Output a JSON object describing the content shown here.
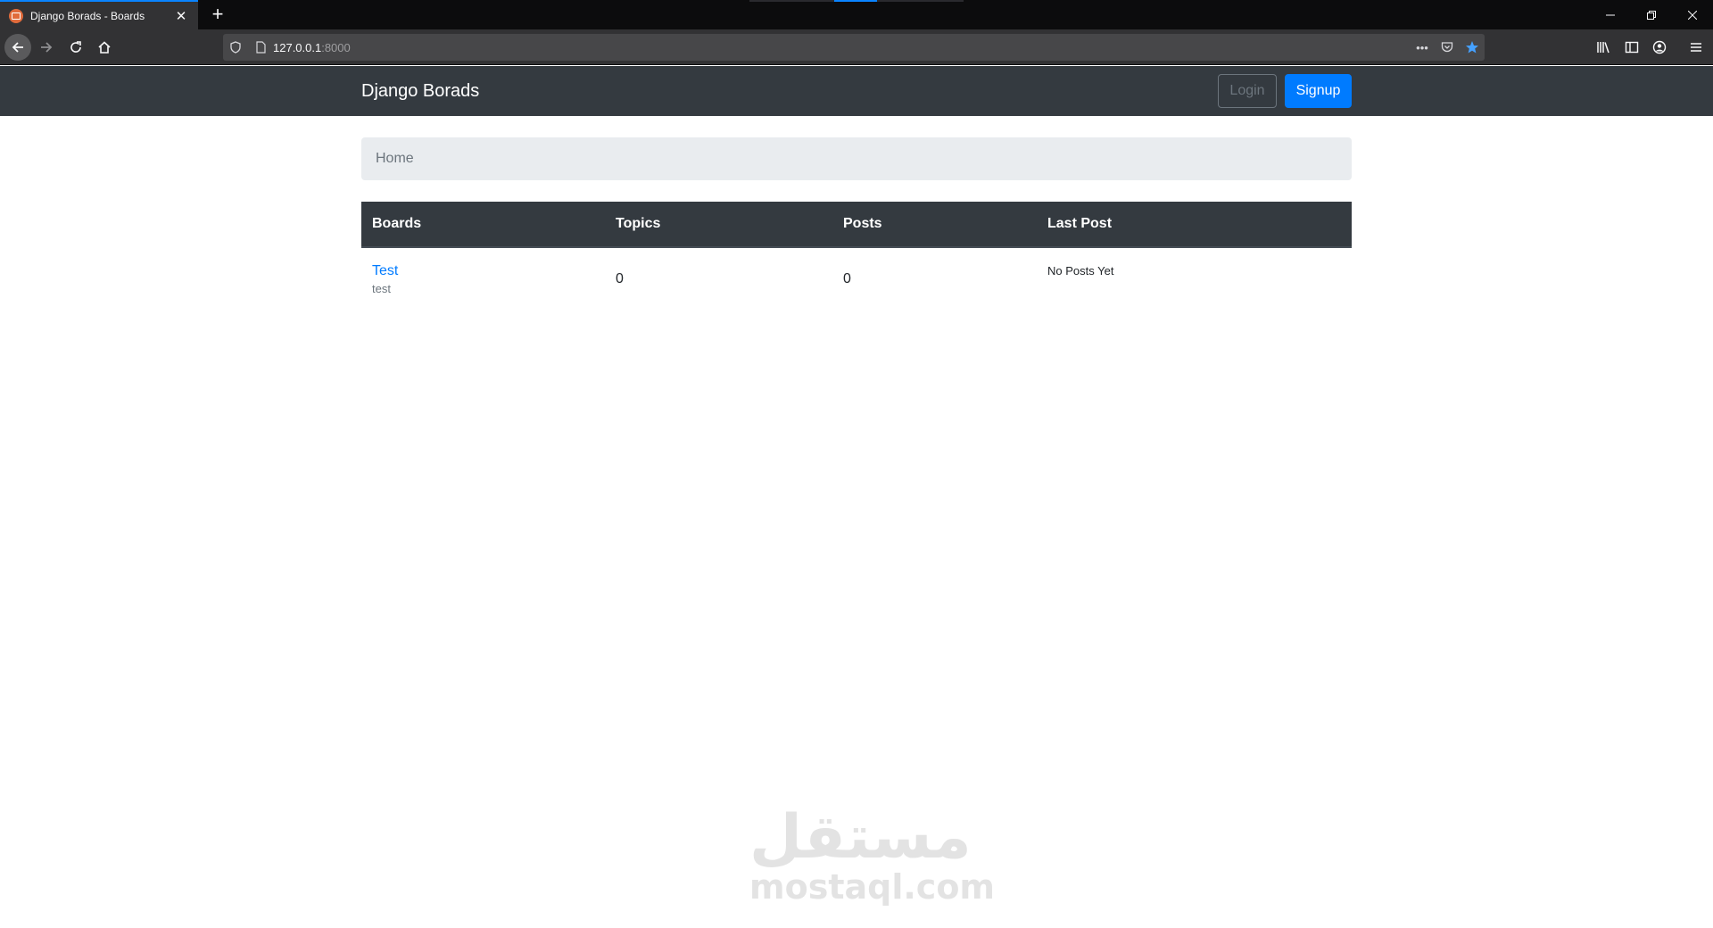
{
  "browser": {
    "tab_title": "Django Borads - Boards",
    "url_host": "127.0.0.1",
    "url_port": ":8000"
  },
  "site": {
    "brand": "Django Borads",
    "login_label": "Login",
    "signup_label": "Signup"
  },
  "breadcrumb": {
    "home": "Home"
  },
  "table": {
    "headers": [
      "Boards",
      "Topics",
      "Posts",
      "Last Post"
    ],
    "rows": [
      {
        "name": "Test",
        "description": "test",
        "topics": "0",
        "posts": "0",
        "last_post": "No Posts Yet"
      }
    ]
  },
  "watermark": {
    "arabic": "مستقل",
    "latin": "mostaql.com"
  },
  "colors": {
    "navbar": "#343a40",
    "primary": "#007bff",
    "breadcrumb_bg": "#e9ecef"
  }
}
